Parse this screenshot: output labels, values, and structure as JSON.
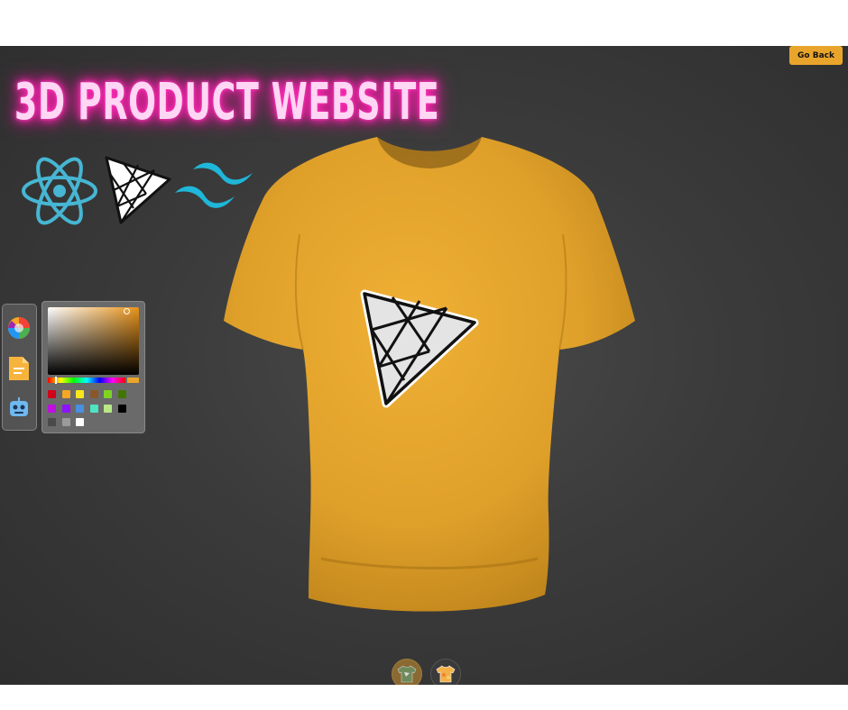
{
  "header": {
    "go_back_label": "Go Back",
    "accent_color": "#e9a52b"
  },
  "hero": {
    "title": "3D PRODUCT WEBSITE"
  },
  "tech_logos": [
    {
      "name": "react-icon"
    },
    {
      "name": "threejs-icon"
    },
    {
      "name": "tailwind-icon"
    }
  ],
  "editor_tabs": [
    {
      "name": "colorpicker-icon"
    },
    {
      "name": "filepicker-icon"
    },
    {
      "name": "aipicker-icon"
    }
  ],
  "color_picker": {
    "selected_color": "#e9a52b",
    "swatches": [
      "#d0021b",
      "#f5a623",
      "#f8e71c",
      "#8b572a",
      "#7ed321",
      "#417505",
      "#bd10e0",
      "#9013fe",
      "#4a90e2",
      "#50e3c2",
      "#b8e986",
      "#000000",
      "#4a4a4a",
      "#9b9b9b",
      "#ffffff"
    ]
  },
  "product": {
    "shirt_color": "#e9a52b",
    "decal": "threejs-logo"
  },
  "filter_tabs": [
    {
      "name": "logo-shirt-icon",
      "active": true
    },
    {
      "name": "full-texture-icon",
      "active": false
    }
  ]
}
